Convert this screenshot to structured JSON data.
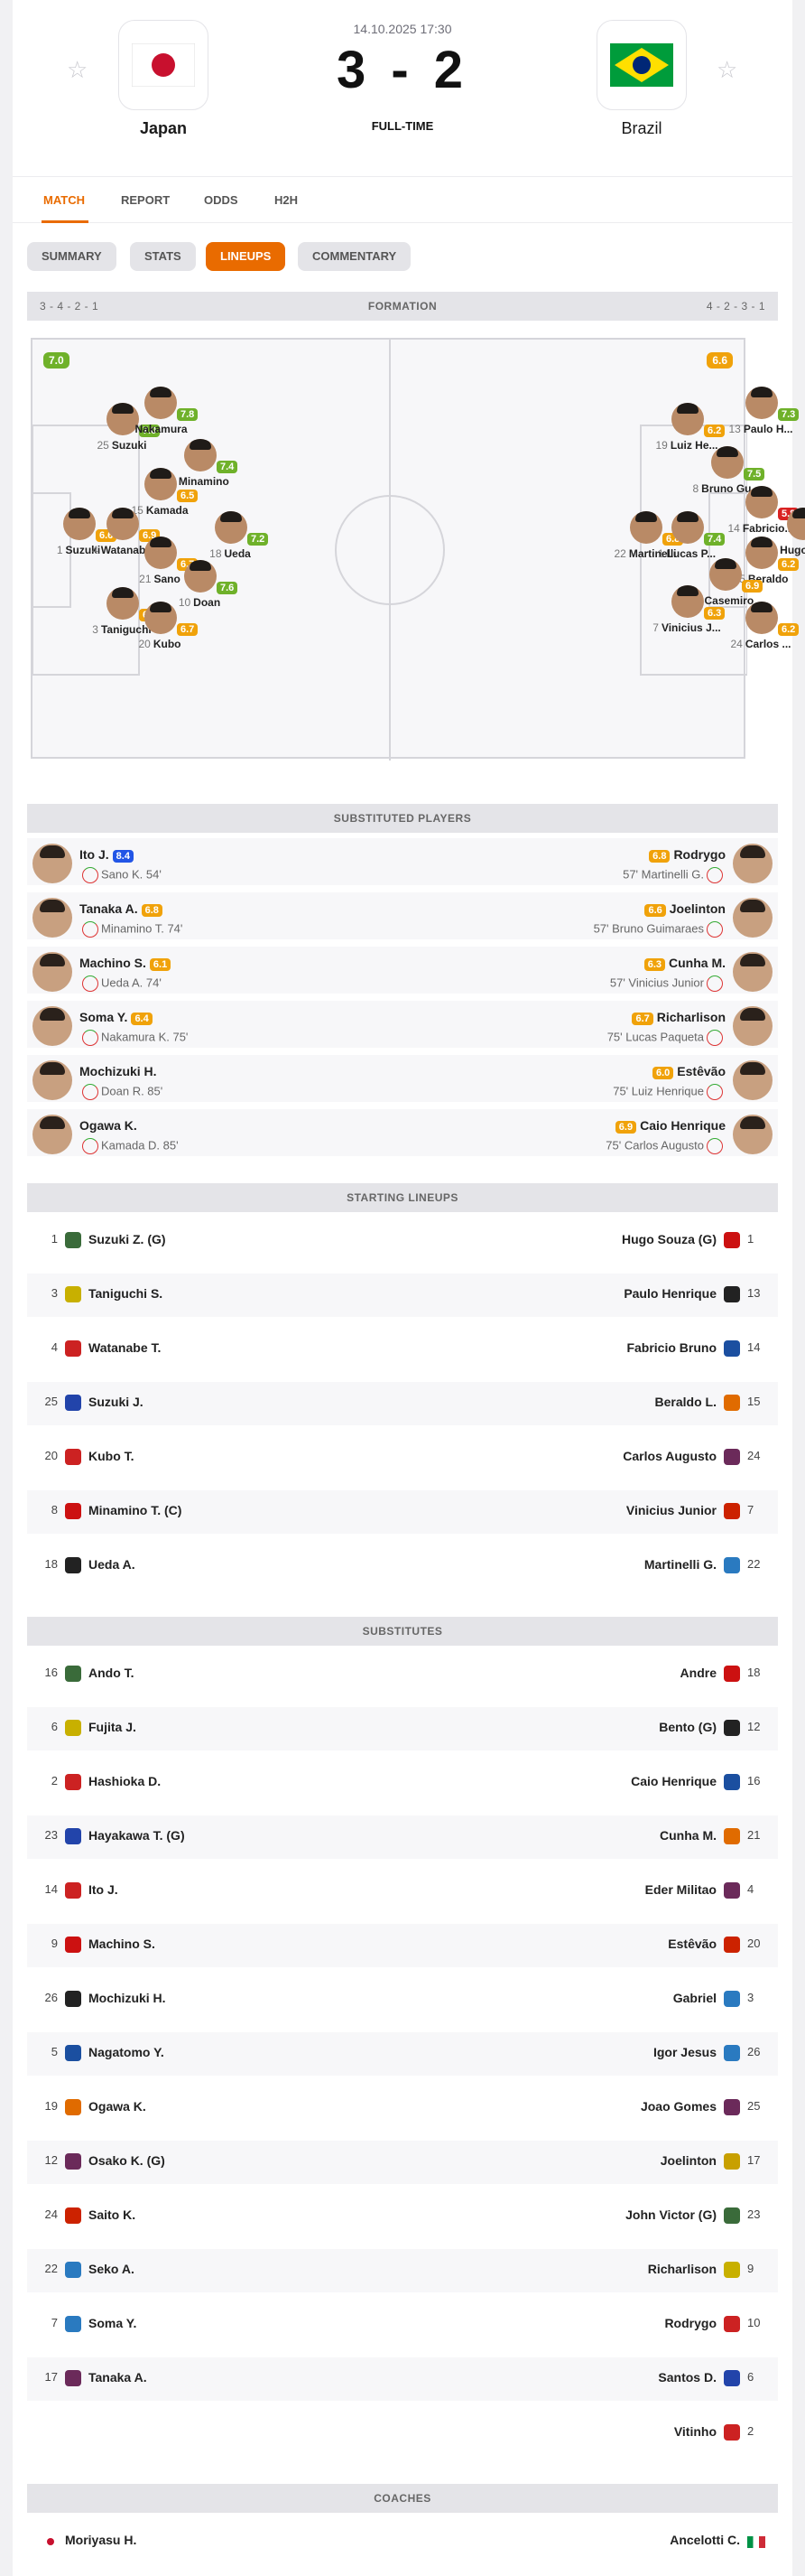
{
  "header": {
    "date": "14.10.2025 17:30",
    "score": "3 - 2",
    "status": "FULL-TIME",
    "home": {
      "name": "Japan"
    },
    "away": {
      "name": "Brazil"
    }
  },
  "nav": {
    "tabs": [
      "MATCH",
      "REPORT",
      "ODDS",
      "H2H"
    ],
    "active": "MATCH"
  },
  "subtabs": {
    "items": [
      "SUMMARY",
      "STATS",
      "LINEUPS",
      "COMMENTARY"
    ],
    "active": "LINEUPS"
  },
  "formation": {
    "title": "FORMATION",
    "home": "3 - 4 - 2 - 1",
    "away": "4 - 2 - 3 - 1",
    "home_avg": "7.0",
    "away_avg": "6.6",
    "home_players": [
      {
        "num": "25",
        "name": "Suzuki",
        "rating": "7.0"
      },
      {
        "num": "",
        "name": "Nakamura",
        "rating": "7.8"
      },
      {
        "num": "8",
        "name": "Minamino",
        "rating": "7.4"
      },
      {
        "num": "15",
        "name": "Kamada",
        "rating": "6.5"
      },
      {
        "num": "1",
        "name": "Suzuki",
        "rating": "6.6"
      },
      {
        "num": "4",
        "name": "Watanabe",
        "rating": "6.9"
      },
      {
        "num": "18",
        "name": "Ueda",
        "rating": "7.2"
      },
      {
        "num": "21",
        "name": "Sano",
        "rating": "6.7"
      },
      {
        "num": "10",
        "name": "Doan",
        "rating": "7.6"
      },
      {
        "num": "3",
        "name": "Taniguchi",
        "rating": "6.6"
      },
      {
        "num": "20",
        "name": "Kubo",
        "rating": "6.7"
      }
    ],
    "away_players": [
      {
        "num": "19",
        "name": "Luiz He...",
        "rating": "6.2"
      },
      {
        "num": "13",
        "name": "Paulo H...",
        "rating": "7.3"
      },
      {
        "num": "8",
        "name": "Bruno Gu...",
        "rating": "7.5"
      },
      {
        "num": "14",
        "name": "Fabricio...",
        "rating": "5.8"
      },
      {
        "num": "22",
        "name": "Martinelli",
        "rating": "6.8"
      },
      {
        "num": "1",
        "name": "Lucas P...",
        "rating": "7.4"
      },
      {
        "num": "1",
        "name": "Hugo So...",
        "rating": "6.0"
      },
      {
        "num": "15",
        "name": "Beraldo",
        "rating": "6.2"
      },
      {
        "num": "5",
        "name": "Casemiro",
        "rating": "6.9"
      },
      {
        "num": "7",
        "name": "Vinicius J...",
        "rating": "6.3"
      },
      {
        "num": "24",
        "name": "Carlos ...",
        "rating": "6.2"
      }
    ]
  },
  "substituted": {
    "title": "SUBSTITUTED PLAYERS",
    "rows": [
      {
        "hname": "Ito J.",
        "hrating": "8.4",
        "hsub": "Sano K. 54'",
        "aname": "Rodrygo",
        "arating": "6.8",
        "asub": "57' Martinelli G."
      },
      {
        "hname": "Tanaka A.",
        "hrating": "6.8",
        "hsub": "Minamino T. 74'",
        "aname": "Joelinton",
        "arating": "6.6",
        "asub": "57' Bruno Guimaraes"
      },
      {
        "hname": "Machino S.",
        "hrating": "6.1",
        "hsub": "Ueda A. 74'",
        "aname": "Cunha M.",
        "arating": "6.3",
        "asub": "57' Vinicius Junior"
      },
      {
        "hname": "Soma Y.",
        "hrating": "6.4",
        "hsub": "Nakamura K. 75'",
        "aname": "Richarlison",
        "arating": "6.7",
        "asub": "75' Lucas Paqueta"
      },
      {
        "hname": "Mochizuki H.",
        "hrating": "",
        "hsub": "Doan R. 85'",
        "aname": "Estêvão",
        "arating": "6.0",
        "asub": "75' Luiz Henrique"
      },
      {
        "hname": "Ogawa K.",
        "hrating": "",
        "hsub": "Kamada D. 85'",
        "aname": "Caio Henrique",
        "arating": "6.9",
        "asub": "75' Carlos Augusto"
      }
    ]
  },
  "starting": {
    "title": "STARTING LINEUPS",
    "rows": [
      {
        "hn": "1",
        "h": "Suzuki Z. (G)",
        "a": "Hugo Souza (G)",
        "an": "1"
      },
      {
        "hn": "3",
        "h": "Taniguchi S.",
        "a": "Paulo Henrique",
        "an": "13"
      },
      {
        "hn": "4",
        "h": "Watanabe T.",
        "a": "Fabricio Bruno",
        "an": "14"
      },
      {
        "hn": "25",
        "h": "Suzuki J.",
        "a": "Beraldo L.",
        "an": "15"
      },
      {
        "hn": "20",
        "h": "Kubo T.",
        "a": "Carlos Augusto",
        "an": "24"
      },
      {
        "hn": "8",
        "h": "Minamino T. (C)",
        "a": "Vinicius Junior",
        "an": "7"
      },
      {
        "hn": "18",
        "h": "Ueda A.",
        "a": "Martinelli G.",
        "an": "22"
      }
    ]
  },
  "substitutes": {
    "title": "SUBSTITUTES",
    "rows": [
      {
        "hn": "16",
        "h": "Ando T.",
        "a": "Andre",
        "an": "18"
      },
      {
        "hn": "6",
        "h": "Fujita J.",
        "a": "Bento (G)",
        "an": "12"
      },
      {
        "hn": "2",
        "h": "Hashioka D.",
        "a": "Caio Henrique",
        "an": "16"
      },
      {
        "hn": "23",
        "h": "Hayakawa T. (G)",
        "a": "Cunha M.",
        "an": "21"
      },
      {
        "hn": "14",
        "h": "Ito J.",
        "a": "Eder Militao",
        "an": "4"
      },
      {
        "hn": "9",
        "h": "Machino S.",
        "a": "Estêvão",
        "an": "20"
      },
      {
        "hn": "26",
        "h": "Mochizuki H.",
        "a": "Gabriel",
        "an": "3"
      },
      {
        "hn": "5",
        "h": "Nagatomo Y.",
        "a": "Igor Jesus",
        "an": "26"
      },
      {
        "hn": "19",
        "h": "Ogawa K.",
        "a": "Joao Gomes",
        "an": "25"
      },
      {
        "hn": "12",
        "h": "Osako K. (G)",
        "a": "Joelinton",
        "an": "17"
      },
      {
        "hn": "24",
        "h": "Saito K.",
        "a": "John Victor (G)",
        "an": "23"
      },
      {
        "hn": "22",
        "h": "Seko A.",
        "a": "Richarlison",
        "an": "9"
      },
      {
        "hn": "7",
        "h": "Soma Y.",
        "a": "Rodrygo",
        "an": "10"
      },
      {
        "hn": "17",
        "h": "Tanaka A.",
        "a": "Santos D.",
        "an": "6"
      },
      {
        "hn": "",
        "h": "",
        "a": "Vitinho",
        "an": "2"
      }
    ]
  },
  "coaches": {
    "title": "COACHES",
    "home": "Moriyasu H.",
    "away": "Ancelotti C."
  },
  "colors": {
    "accent": "#e96b00",
    "rating_green": "#6fb12a",
    "rating_orange": "#f0a20a",
    "rating_red": "#d92222"
  }
}
